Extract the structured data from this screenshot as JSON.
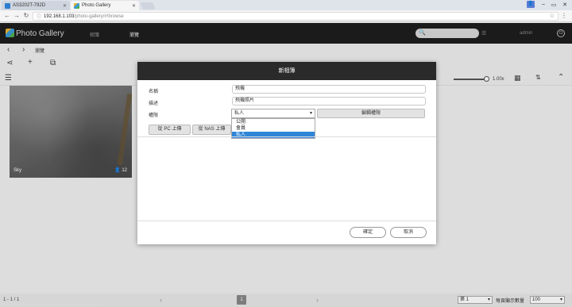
{
  "browser": {
    "tabs": [
      {
        "label": "AS3202T-792D",
        "active": false,
        "icon": "nas-icon"
      },
      {
        "label": "Photo Gallery",
        "active": true,
        "icon": "photo-gallery-icon"
      }
    ],
    "url_host": "192.168.1.103",
    "url_path": "/photo-gallery/#!browse"
  },
  "app": {
    "title": "Photo Gallery",
    "nav": [
      "相簿",
      "瀏覽"
    ],
    "user": "admin"
  },
  "breadcrumb": {
    "current": "瀏覽"
  },
  "view": {
    "zoom": "1.00x"
  },
  "album": {
    "name": "Sky",
    "count": "12"
  },
  "footer": {
    "page_count": "1 - 1 / 1",
    "current_page": "1",
    "page_select": "第 1",
    "per_page_label": "每頁顯示數量",
    "per_page": "100"
  },
  "dialog": {
    "title": "新相簿",
    "name_label": "名稱",
    "name_value": "飛機",
    "desc_label": "描述",
    "desc_value": "飛機照片",
    "perm_label": "權限",
    "perm_value": "私人",
    "perm_options": [
      "公開",
      "會員",
      "私人"
    ],
    "edit_perm_button": "編輯權限",
    "upload_pc_button": "從 PC 上傳",
    "upload_nas_button": "從 NAS 上傳",
    "ok_button": "確定",
    "cancel_button": "取消"
  },
  "colors": {
    "header_bg": "#1e1e1e",
    "modal_head_bg": "#2a2a2a",
    "selected_option": "#2f86d8"
  }
}
